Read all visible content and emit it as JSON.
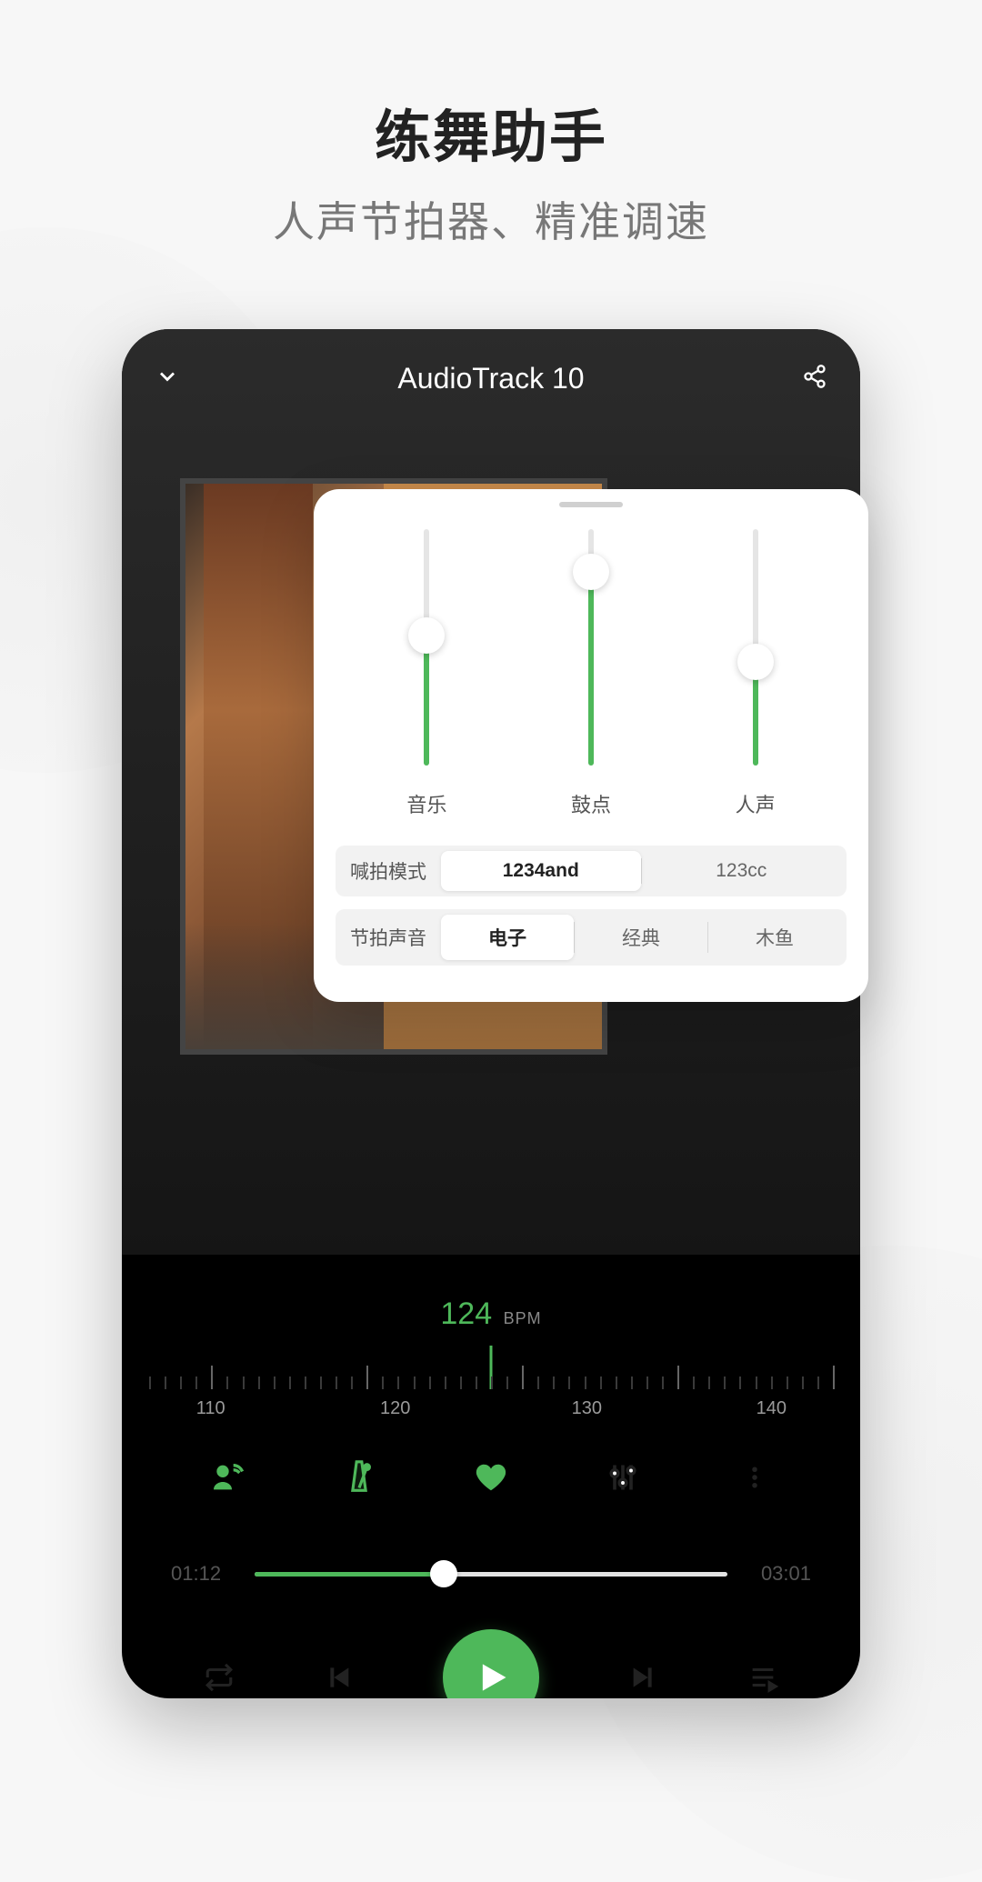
{
  "heading": {
    "title": "练舞助手",
    "subtitle": "人声节拍器、精准调速"
  },
  "player": {
    "track_title": "AudioTrack 10",
    "bpm_value": "124",
    "bpm_unit": "BPM",
    "ruler_labels": [
      "110",
      "120",
      "130",
      "140"
    ],
    "progress": {
      "elapsed": "01:12",
      "total": "03:01",
      "percent": 40
    }
  },
  "popup": {
    "sliders": [
      {
        "label": "音乐",
        "value_pct": 55
      },
      {
        "label": "鼓点",
        "value_pct": 82
      },
      {
        "label": "人声",
        "value_pct": 44
      }
    ],
    "rows": [
      {
        "label": "喊拍模式",
        "options": [
          "1234and",
          "123cc"
        ],
        "active": 0
      },
      {
        "label": "节拍声音",
        "options": [
          "电子",
          "经典",
          "木鱼"
        ],
        "active": 0
      }
    ]
  },
  "colors": {
    "accent": "#4eb85a"
  }
}
